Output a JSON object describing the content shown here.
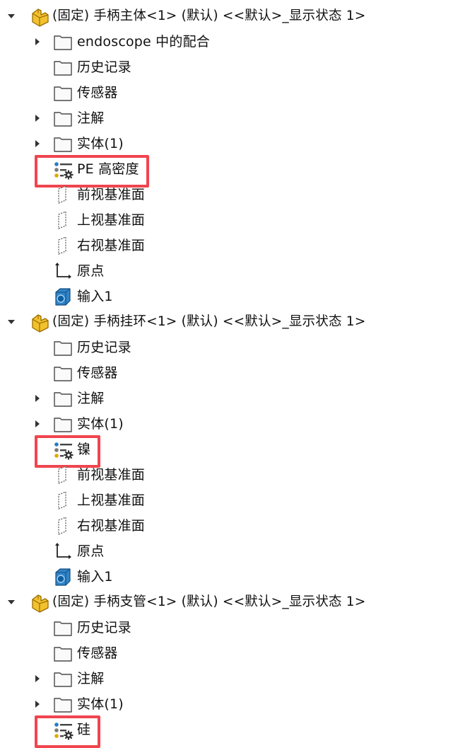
{
  "colors": {
    "highlight": "#f0454f",
    "folder_frame": "#4a4a4a",
    "part_icon": "#f2c12e",
    "solid_blue": "#2b7bc0"
  },
  "tree": {
    "components": [
      {
        "label": "(固定) 手柄主体<1> (默认) <<默认>_显示状态 1>",
        "icon": "part-icon",
        "expanded": true,
        "children": [
          {
            "label": "endoscope 中的配合",
            "icon": "mates-folder-icon",
            "expandable": true
          },
          {
            "label": "历史记录",
            "icon": "history-folder-icon",
            "expandable": false
          },
          {
            "label": "传感器",
            "icon": "sensor-folder-icon",
            "expandable": false
          },
          {
            "label": "注解",
            "icon": "annotation-folder-icon",
            "expandable": true
          },
          {
            "label": "实体(1)",
            "icon": "solid-bodies-folder-icon",
            "expandable": true
          },
          {
            "label": "PE 高密度",
            "icon": "material-icon",
            "expandable": false,
            "highlighted": true
          },
          {
            "label": "前视基准面",
            "icon": "plane-icon",
            "expandable": false
          },
          {
            "label": "上视基准面",
            "icon": "plane-icon",
            "expandable": false
          },
          {
            "label": "右视基准面",
            "icon": "plane-icon",
            "expandable": false
          },
          {
            "label": "原点",
            "icon": "origin-icon",
            "expandable": false
          },
          {
            "label": "输入1",
            "icon": "imported-body-icon",
            "expandable": false
          }
        ]
      },
      {
        "label": "(固定) 手柄挂环<1> (默认) <<默认>_显示状态 1>",
        "icon": "part-icon",
        "expanded": true,
        "children": [
          {
            "label": "历史记录",
            "icon": "history-folder-icon",
            "expandable": false
          },
          {
            "label": "传感器",
            "icon": "sensor-folder-icon",
            "expandable": false
          },
          {
            "label": "注解",
            "icon": "annotation-folder-icon",
            "expandable": true
          },
          {
            "label": "实体(1)",
            "icon": "solid-bodies-folder-icon",
            "expandable": true
          },
          {
            "label": "镍",
            "icon": "material-icon",
            "expandable": false,
            "highlighted": true
          },
          {
            "label": "前视基准面",
            "icon": "plane-icon",
            "expandable": false
          },
          {
            "label": "上视基准面",
            "icon": "plane-icon",
            "expandable": false
          },
          {
            "label": "右视基准面",
            "icon": "plane-icon",
            "expandable": false
          },
          {
            "label": "原点",
            "icon": "origin-icon",
            "expandable": false
          },
          {
            "label": "输入1",
            "icon": "imported-body-icon",
            "expandable": false
          }
        ]
      },
      {
        "label": "(固定) 手柄支管<1> (默认) <<默认>_显示状态 1>",
        "icon": "part-icon",
        "expanded": true,
        "children": [
          {
            "label": "历史记录",
            "icon": "history-folder-icon",
            "expandable": false
          },
          {
            "label": "传感器",
            "icon": "sensor-folder-icon",
            "expandable": false
          },
          {
            "label": "注解",
            "icon": "annotation-folder-icon",
            "expandable": true
          },
          {
            "label": "实体(1)",
            "icon": "solid-bodies-folder-icon",
            "expandable": true
          },
          {
            "label": "硅",
            "icon": "material-icon",
            "expandable": false,
            "highlighted": true
          }
        ]
      }
    ]
  }
}
